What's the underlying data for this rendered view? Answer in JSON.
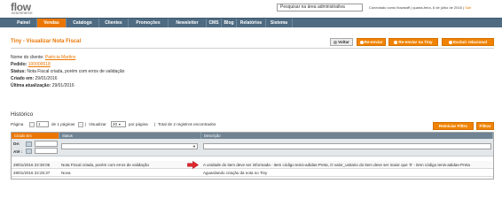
{
  "header": {
    "logo_main": "flow",
    "logo_sub": "ecommerce",
    "search_placeholder": "Pesquisar na área administrativa",
    "user_prefix": "Conectado como flowstaff",
    "date_text": "quarta-feira, 6 de julho de 2016",
    "logout_label": "Sair"
  },
  "nav": {
    "items": [
      "Painel",
      "Vendas",
      "Catalogo",
      "Clientes",
      "Promoções",
      "Newsletter",
      "CMS",
      "Blog",
      "Relatórios",
      "Sistema"
    ],
    "active_index": 1
  },
  "page": {
    "title": "Tiny - Visualizar Nota Fiscal",
    "buttons": {
      "back": "Voltar",
      "resend": "Re-enviar",
      "resend_tiny": "Re-enviar na Tiny",
      "delete": "Excluir relacional"
    }
  },
  "info": {
    "customer_label": "Nome do cliente:",
    "customer_value": "Patricia Martins",
    "order_label": "Pedido:",
    "order_value": "100000618",
    "status_label": "Status:",
    "status_value": "Nota Fiscal criada, porém com erros de validação",
    "created_label": "Criado em:",
    "created_value": "29/01/2016",
    "updated_label": "Última atualização:",
    "updated_value": "29/01/2016"
  },
  "history": {
    "title": "Histórico",
    "pager": {
      "page_label": "Página",
      "page_value": "1",
      "of_pages": "de 1 páginas",
      "view_label": "Visualizar",
      "per_page": "20",
      "per_page_suffix": "por página",
      "total": "Total de 2 registros encontrados"
    },
    "reset_filter_label": "Reiniciar Filtro",
    "filter_label": "Filtrar",
    "columns": [
      "Criado Em",
      "Status",
      "Descrição"
    ],
    "filter_from": "De:",
    "filter_to": "Até :",
    "rows": [
      {
        "created": "28/01/2016 22:30:05",
        "status": "Nota Fiscal criada, porém com erros de validação",
        "description": "A unidade do item deve ser informada - item código tenis-adidas-Preta, O valor_unitario do item deve ser maior que '0' - item código tenis-adidas-Preta"
      },
      {
        "created": "28/01/2016 22:25:37",
        "status": "Nova",
        "description": "Aguardando criação da nota no Tiny"
      }
    ]
  },
  "colors": {
    "accent": "#ea7601",
    "nav_bg": "#4e6b82",
    "grid_header": "#6f8392",
    "arrow": "#e0282f"
  }
}
